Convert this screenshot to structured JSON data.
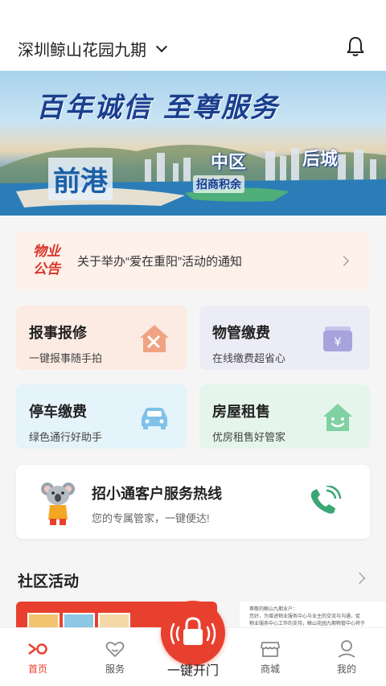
{
  "header": {
    "community_name": "深圳鲸山花园九期",
    "chevron_icon": "chevron-down-icon",
    "bell_icon": "bell-icon"
  },
  "banner": {
    "slogan": "百年诚信 至尊服务",
    "tags": [
      "前港",
      "中区",
      "后城"
    ],
    "logo_text": "招商积余"
  },
  "notice": {
    "badge_line1": "物业",
    "badge_line2": "公告",
    "text": "关于举办“爱在重阳”活动的通知"
  },
  "services": [
    {
      "title": "报事报修",
      "subtitle": "一键报事随手拍",
      "icon": "repair-house-icon",
      "color": "#f0a384"
    },
    {
      "title": "物管缴费",
      "subtitle": "在线缴费超省心",
      "icon": "wallet-icon",
      "color": "#a7a3dd"
    },
    {
      "title": "停车缴费",
      "subtitle": "绿色通行好助手",
      "icon": "car-icon",
      "color": "#7fc1e8"
    },
    {
      "title": "房屋租售",
      "subtitle": "优房租售好管家",
      "icon": "smile-house-icon",
      "color": "#7fd1a2"
    }
  ],
  "hotline": {
    "title": "招小通客户服务热线",
    "subtitle": "您的专属管家，一键便达!"
  },
  "activity": {
    "section_title": "社区活动",
    "card2_lines": [
      "尊敬的鲸山九期业户：",
      "您好，为增进物业服务中心与业主的交流与沟通，促",
      "物业服务中心工作的支持，鲸山花园九期物管中心将于"
    ]
  },
  "tabbar": {
    "home": "首页",
    "service": "服务",
    "unlock": "一键开门",
    "mall": "商城",
    "mine": "我的"
  },
  "colors": {
    "accent": "#e8402e"
  }
}
